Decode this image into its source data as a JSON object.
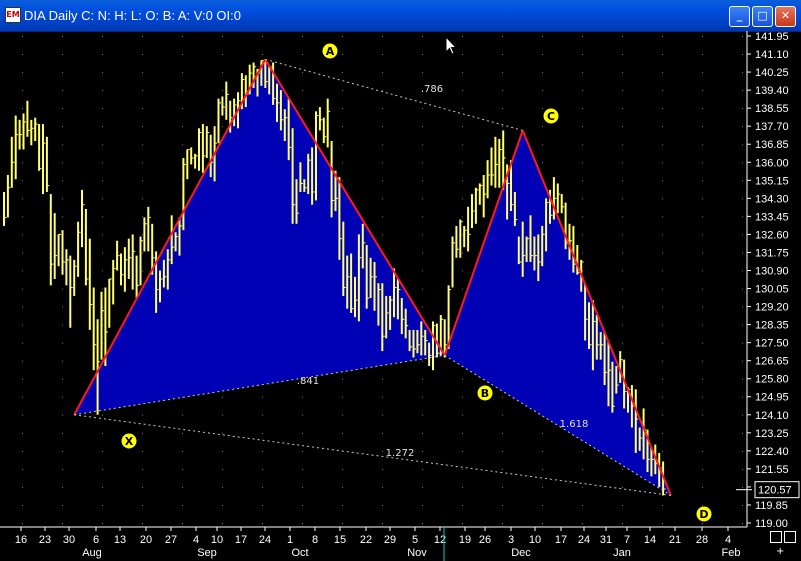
{
  "window": {
    "title": "DIA Daily C: N: H: L: O: B: A: V:0 OI:0",
    "icon": "chart-app-icon",
    "controls": {
      "minimize": "_",
      "maximize": "□",
      "close": "✕"
    }
  },
  "chart_data": {
    "type": "bar",
    "symbol": "DIA",
    "price_axis": {
      "ticks": [
        "141.95",
        "141.10",
        "140.25",
        "139.40",
        "138.55",
        "137.70",
        "136.85",
        "136.00",
        "135.15",
        "134.30",
        "133.45",
        "132.60",
        "131.75",
        "130.90",
        "130.05",
        "129.20",
        "128.35",
        "127.50",
        "126.65",
        "125.80",
        "124.95",
        "124.10",
        "123.25",
        "122.40",
        "121.55",
        "120.70",
        "119.85",
        "119.00"
      ],
      "last_price": "120.57",
      "ylim": [
        119.0,
        141.95
      ]
    },
    "date_axis": {
      "days": [
        "16",
        "23",
        "30",
        "6",
        "13",
        "20",
        "27",
        "4",
        "10",
        "17",
        "24",
        "1",
        "8",
        "15",
        "22",
        "29",
        "5",
        "12",
        "19",
        "26",
        "3",
        "10",
        "17",
        "24",
        "31",
        "7",
        "14",
        "21",
        "28",
        "4"
      ],
      "months": [
        "Aug",
        "Sep",
        "Oct",
        "Nov",
        "Dec",
        "Jan",
        "Feb"
      ]
    },
    "pattern": {
      "points": [
        {
          "label": "X",
          "bar": 18,
          "price": 124.1
        },
        {
          "label": "A",
          "bar": 67,
          "price": 140.85
        },
        {
          "label": "B",
          "bar": 113,
          "price": 126.9
        },
        {
          "label": "C",
          "bar": 133,
          "price": 137.5
        },
        {
          "label": "D",
          "bar": 171,
          "price": 120.3
        }
      ],
      "ratios": [
        {
          "text": ".786",
          "from": "A",
          "to": "C"
        },
        {
          "text": ".841",
          "from": "X",
          "to": "B"
        },
        {
          "text": "1.618",
          "from": "B",
          "to": "D"
        },
        {
          "text": "1.272",
          "from": "X",
          "to": "D"
        }
      ]
    },
    "ohlc": [
      {
        "h": 134.6,
        "l": 133.0,
        "c": 133.4
      },
      {
        "h": 135.4,
        "l": 133.4,
        "c": 134.8
      },
      {
        "h": 137.2,
        "l": 134.8,
        "c": 136.0
      },
      {
        "h": 138.2,
        "l": 135.2,
        "c": 137.3
      },
      {
        "h": 138.0,
        "l": 136.6,
        "c": 137.3
      },
      {
        "h": 138.3,
        "l": 136.6,
        "c": 137.9
      },
      {
        "h": 138.9,
        "l": 137.2,
        "c": 137.5
      },
      {
        "h": 138.0,
        "l": 136.8,
        "c": 137.6
      },
      {
        "h": 138.1,
        "l": 137.0,
        "c": 137.8
      },
      {
        "h": 137.8,
        "l": 135.6,
        "c": 135.7
      },
      {
        "h": 137.8,
        "l": 134.5,
        "c": 136.9
      },
      {
        "h": 137.2,
        "l": 134.6,
        "c": 134.9
      },
      {
        "h": 134.5,
        "l": 130.2,
        "c": 131.2
      },
      {
        "h": 133.6,
        "l": 130.5,
        "c": 131.6
      },
      {
        "h": 132.6,
        "l": 131.1,
        "c": 132.6
      },
      {
        "h": 132.8,
        "l": 130.7,
        "c": 131.3
      },
      {
        "h": 131.9,
        "l": 130.2,
        "c": 131.4
      },
      {
        "h": 131.6,
        "l": 128.2,
        "c": 130.1
      },
      {
        "h": 131.4,
        "l": 129.7,
        "c": 131.1
      },
      {
        "h": 133.2,
        "l": 130.6,
        "c": 132.7
      },
      {
        "h": 134.7,
        "l": 132.0,
        "c": 134.0
      },
      {
        "h": 133.8,
        "l": 130.2,
        "c": 130.5
      },
      {
        "h": 132.4,
        "l": 128.1,
        "c": 129.3
      },
      {
        "h": 130.1,
        "l": 126.2,
        "c": 127.4
      },
      {
        "h": 128.6,
        "l": 124.1,
        "c": 126.6
      },
      {
        "h": 129.9,
        "l": 126.7,
        "c": 129.0
      },
      {
        "h": 130.1,
        "l": 126.4,
        "c": 128.0
      },
      {
        "h": 130.5,
        "l": 128.2,
        "c": 130.5
      },
      {
        "h": 131.4,
        "l": 129.3,
        "c": 131.0
      },
      {
        "h": 132.3,
        "l": 130.9,
        "c": 131.6
      },
      {
        "h": 131.7,
        "l": 130.2,
        "c": 130.7
      },
      {
        "h": 132.0,
        "l": 129.9,
        "c": 131.4
      },
      {
        "h": 132.4,
        "l": 130.5,
        "c": 131.5
      },
      {
        "h": 132.6,
        "l": 130.0,
        "c": 131.8
      },
      {
        "h": 131.6,
        "l": 129.6,
        "c": 130.2
      },
      {
        "h": 132.5,
        "l": 130.2,
        "c": 132.3
      },
      {
        "h": 133.4,
        "l": 131.8,
        "c": 133.1
      },
      {
        "h": 133.9,
        "l": 131.8,
        "c": 133.4
      },
      {
        "h": 133.1,
        "l": 130.7,
        "c": 131.5
      },
      {
        "h": 131.8,
        "l": 128.9,
        "c": 130.0
      },
      {
        "h": 130.9,
        "l": 129.4,
        "c": 130.5
      },
      {
        "h": 131.4,
        "l": 130.1,
        "c": 130.6
      },
      {
        "h": 131.9,
        "l": 130.0,
        "c": 131.4
      },
      {
        "h": 133.5,
        "l": 131.2,
        "c": 132.0
      },
      {
        "h": 132.7,
        "l": 131.8,
        "c": 132.5
      },
      {
        "h": 133.4,
        "l": 131.6,
        "c": 133.0
      },
      {
        "h": 136.2,
        "l": 132.8,
        "c": 135.9
      },
      {
        "h": 136.6,
        "l": 135.2,
        "c": 136.6
      },
      {
        "h": 136.7,
        "l": 135.9,
        "c": 136.2
      },
      {
        "h": 136.4,
        "l": 135.7,
        "c": 136.3
      },
      {
        "h": 137.6,
        "l": 135.6,
        "c": 137.4
      },
      {
        "h": 137.8,
        "l": 135.5,
        "c": 136.3
      },
      {
        "h": 137.7,
        "l": 136.2,
        "c": 137.4
      },
      {
        "h": 137.3,
        "l": 135.3,
        "c": 136.0
      },
      {
        "h": 137.7,
        "l": 135.1,
        "c": 136.9
      },
      {
        "h": 139.0,
        "l": 136.9,
        "c": 138.8
      },
      {
        "h": 139.1,
        "l": 138.2,
        "c": 138.6
      },
      {
        "h": 139.8,
        "l": 138.0,
        "c": 139.2
      },
      {
        "h": 138.9,
        "l": 137.4,
        "c": 138.1
      },
      {
        "h": 139.0,
        "l": 137.7,
        "c": 138.7
      },
      {
        "h": 139.3,
        "l": 137.6,
        "c": 138.9
      },
      {
        "h": 140.2,
        "l": 138.5,
        "c": 139.9
      },
      {
        "h": 140.1,
        "l": 138.6,
        "c": 139.2
      },
      {
        "h": 140.6,
        "l": 139.2,
        "c": 140.2
      },
      {
        "h": 140.7,
        "l": 139.5,
        "c": 140.5
      },
      {
        "h": 140.4,
        "l": 139.1,
        "c": 140.2
      },
      {
        "h": 140.8,
        "l": 139.6,
        "c": 140.8
      },
      {
        "h": 140.8,
        "l": 139.5,
        "c": 139.8
      },
      {
        "h": 140.5,
        "l": 139.2,
        "c": 140.5
      },
      {
        "h": 140.7,
        "l": 138.7,
        "c": 139.0
      },
      {
        "h": 139.7,
        "l": 137.9,
        "c": 138.8
      },
      {
        "h": 139.4,
        "l": 137.5,
        "c": 138.0
      },
      {
        "h": 138.5,
        "l": 137.0,
        "c": 138.1
      },
      {
        "h": 139.0,
        "l": 136.1,
        "c": 136.7
      },
      {
        "h": 137.6,
        "l": 133.1,
        "c": 134.0
      },
      {
        "h": 135.2,
        "l": 133.1,
        "c": 133.6
      },
      {
        "h": 136.0,
        "l": 134.6,
        "c": 135.0
      },
      {
        "h": 135.2,
        "l": 134.6,
        "c": 134.8
      },
      {
        "h": 136.4,
        "l": 134.5,
        "c": 136.1
      },
      {
        "h": 136.7,
        "l": 134.0,
        "c": 134.6
      },
      {
        "h": 138.4,
        "l": 134.2,
        "c": 138.2
      },
      {
        "h": 138.6,
        "l": 137.5,
        "c": 138.0
      },
      {
        "h": 138.1,
        "l": 136.9,
        "c": 137.2
      },
      {
        "h": 139.0,
        "l": 136.7,
        "c": 138.4
      },
      {
        "h": 137.0,
        "l": 133.4,
        "c": 134.2
      },
      {
        "h": 135.6,
        "l": 133.7,
        "c": 134.3
      },
      {
        "h": 135.3,
        "l": 131.4,
        "c": 132.4
      },
      {
        "h": 133.2,
        "l": 129.7,
        "c": 130.1
      },
      {
        "h": 131.6,
        "l": 129.1,
        "c": 130.6
      },
      {
        "h": 131.7,
        "l": 128.9,
        "c": 129.1
      },
      {
        "h": 130.6,
        "l": 128.7,
        "c": 129.5
      },
      {
        "h": 132.6,
        "l": 128.5,
        "c": 131.5
      },
      {
        "h": 133.1,
        "l": 131.0,
        "c": 132.2
      },
      {
        "h": 132.1,
        "l": 129.1,
        "c": 129.6
      },
      {
        "h": 131.5,
        "l": 129.6,
        "c": 130.6
      },
      {
        "h": 131.3,
        "l": 129.0,
        "c": 130.6
      },
      {
        "h": 130.3,
        "l": 128.3,
        "c": 130.0
      },
      {
        "h": 130.3,
        "l": 127.1,
        "c": 127.8
      },
      {
        "h": 129.7,
        "l": 127.7,
        "c": 128.9
      },
      {
        "h": 129.7,
        "l": 128.1,
        "c": 129.5
      },
      {
        "h": 131.0,
        "l": 128.7,
        "c": 130.1
      },
      {
        "h": 130.5,
        "l": 128.6,
        "c": 130.0
      },
      {
        "h": 129.6,
        "l": 127.9,
        "c": 128.6
      },
      {
        "h": 129.1,
        "l": 127.7,
        "c": 128.3
      },
      {
        "h": 128.1,
        "l": 127.1,
        "c": 127.3
      },
      {
        "h": 128.1,
        "l": 126.8,
        "c": 127.2
      },
      {
        "h": 128.1,
        "l": 127.0,
        "c": 127.4
      },
      {
        "h": 128.5,
        "l": 126.9,
        "c": 127.8
      },
      {
        "h": 128.1,
        "l": 126.9,
        "c": 127.6
      },
      {
        "h": 127.5,
        "l": 126.4,
        "c": 126.9
      },
      {
        "h": 128.5,
        "l": 126.2,
        "c": 128.3
      },
      {
        "h": 128.4,
        "l": 126.8,
        "c": 127.0
      },
      {
        "h": 128.8,
        "l": 126.9,
        "c": 128.6
      },
      {
        "h": 128.6,
        "l": 126.8,
        "c": 127.4
      },
      {
        "h": 130.2,
        "l": 127.2,
        "c": 130.0
      },
      {
        "h": 132.5,
        "l": 130.1,
        "c": 132.2
      },
      {
        "h": 133.0,
        "l": 131.5,
        "c": 131.9
      },
      {
        "h": 133.3,
        "l": 131.5,
        "c": 133.2
      },
      {
        "h": 133.0,
        "l": 132.0,
        "c": 132.8
      },
      {
        "h": 133.9,
        "l": 131.8,
        "c": 132.6
      },
      {
        "h": 134.5,
        "l": 132.9,
        "c": 133.7
      },
      {
        "h": 134.8,
        "l": 133.1,
        "c": 134.7
      },
      {
        "h": 135.0,
        "l": 134.0,
        "c": 134.9
      },
      {
        "h": 135.4,
        "l": 133.4,
        "c": 134.5
      },
      {
        "h": 136.1,
        "l": 134.3,
        "c": 135.4
      },
      {
        "h": 136.7,
        "l": 134.9,
        "c": 135.4
      },
      {
        "h": 137.2,
        "l": 134.8,
        "c": 135.9
      },
      {
        "h": 137.1,
        "l": 134.8,
        "c": 136.6
      },
      {
        "h": 137.5,
        "l": 134.7,
        "c": 136.2
      },
      {
        "h": 135.9,
        "l": 133.3,
        "c": 135.0
      },
      {
        "h": 136.1,
        "l": 133.7,
        "c": 134.0
      },
      {
        "h": 134.6,
        "l": 133.0,
        "c": 133.3
      },
      {
        "h": 132.5,
        "l": 131.2,
        "c": 131.3
      },
      {
        "h": 133.2,
        "l": 130.6,
        "c": 131.6
      },
      {
        "h": 132.5,
        "l": 131.3,
        "c": 132.4
      },
      {
        "h": 133.5,
        "l": 131.3,
        "c": 131.6
      },
      {
        "h": 132.5,
        "l": 130.9,
        "c": 131.6
      },
      {
        "h": 132.6,
        "l": 130.4,
        "c": 131.3
      },
      {
        "h": 133.0,
        "l": 131.1,
        "c": 132.6
      },
      {
        "h": 134.3,
        "l": 131.8,
        "c": 134.1
      },
      {
        "h": 134.7,
        "l": 133.1,
        "c": 133.5
      },
      {
        "h": 135.3,
        "l": 133.3,
        "c": 134.3
      },
      {
        "h": 135.0,
        "l": 133.6,
        "c": 134.5
      },
      {
        "h": 134.5,
        "l": 133.6,
        "c": 133.9
      },
      {
        "h": 134.1,
        "l": 131.9,
        "c": 132.2
      },
      {
        "h": 133.1,
        "l": 131.4,
        "c": 132.3
      },
      {
        "h": 133.0,
        "l": 130.8,
        "c": 131.2
      },
      {
        "h": 132.1,
        "l": 130.7,
        "c": 130.8
      },
      {
        "h": 131.4,
        "l": 129.9,
        "c": 131.3
      },
      {
        "h": 130.3,
        "l": 127.6,
        "c": 128.6
      },
      {
        "h": 129.4,
        "l": 127.2,
        "c": 127.4
      },
      {
        "h": 129.5,
        "l": 126.2,
        "c": 128.5
      },
      {
        "h": 128.8,
        "l": 126.7,
        "c": 127.4
      },
      {
        "h": 128.0,
        "l": 126.7,
        "c": 127.4
      },
      {
        "h": 128.0,
        "l": 125.5,
        "c": 126.1
      },
      {
        "h": 127.6,
        "l": 124.5,
        "c": 126.2
      },
      {
        "h": 126.6,
        "l": 124.2,
        "c": 124.5
      },
      {
        "h": 126.4,
        "l": 125.1,
        "c": 125.5
      },
      {
        "h": 127.1,
        "l": 125.6,
        "c": 126.7
      },
      {
        "h": 126.7,
        "l": 124.4,
        "c": 125.2
      },
      {
        "h": 125.4,
        "l": 124.2,
        "c": 125.3
      },
      {
        "h": 125.5,
        "l": 123.5,
        "c": 124.5
      },
      {
        "h": 125.3,
        "l": 122.3,
        "c": 123.9
      },
      {
        "h": 123.5,
        "l": 122.4,
        "c": 123.0
      },
      {
        "h": 124.4,
        "l": 122.0,
        "c": 123.4
      },
      {
        "h": 123.4,
        "l": 121.4,
        "c": 122.0
      },
      {
        "h": 122.6,
        "l": 121.2,
        "c": 122.0
      },
      {
        "h": 122.7,
        "l": 121.3,
        "c": 121.8
      },
      {
        "h": 122.3,
        "l": 120.7,
        "c": 121.6
      },
      {
        "h": 121.9,
        "l": 120.3,
        "c": 120.6
      }
    ]
  }
}
